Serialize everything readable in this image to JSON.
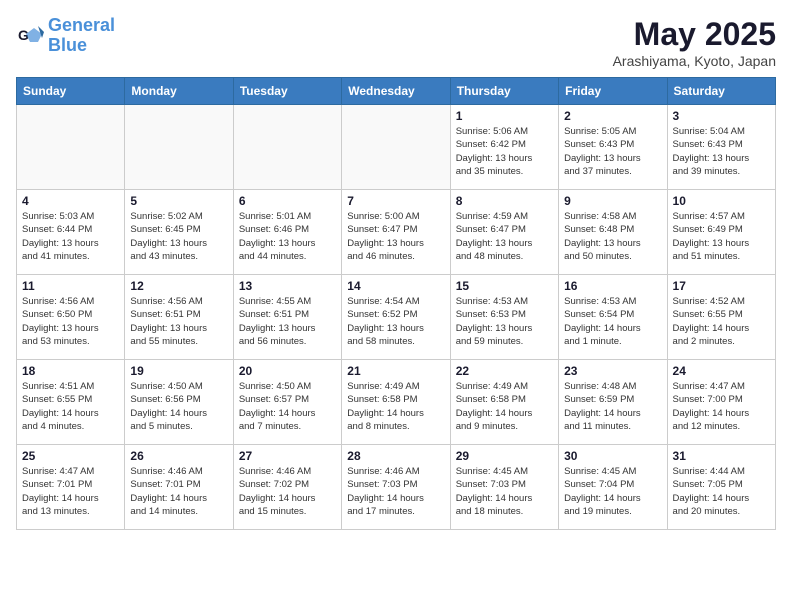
{
  "header": {
    "logo_line1": "General",
    "logo_line2": "Blue",
    "month": "May 2025",
    "location": "Arashiyama, Kyoto, Japan"
  },
  "weekdays": [
    "Sunday",
    "Monday",
    "Tuesday",
    "Wednesday",
    "Thursday",
    "Friday",
    "Saturday"
  ],
  "weeks": [
    [
      {
        "day": "",
        "info": ""
      },
      {
        "day": "",
        "info": ""
      },
      {
        "day": "",
        "info": ""
      },
      {
        "day": "",
        "info": ""
      },
      {
        "day": "1",
        "info": "Sunrise: 5:06 AM\nSunset: 6:42 PM\nDaylight: 13 hours\nand 35 minutes."
      },
      {
        "day": "2",
        "info": "Sunrise: 5:05 AM\nSunset: 6:43 PM\nDaylight: 13 hours\nand 37 minutes."
      },
      {
        "day": "3",
        "info": "Sunrise: 5:04 AM\nSunset: 6:43 PM\nDaylight: 13 hours\nand 39 minutes."
      }
    ],
    [
      {
        "day": "4",
        "info": "Sunrise: 5:03 AM\nSunset: 6:44 PM\nDaylight: 13 hours\nand 41 minutes."
      },
      {
        "day": "5",
        "info": "Sunrise: 5:02 AM\nSunset: 6:45 PM\nDaylight: 13 hours\nand 43 minutes."
      },
      {
        "day": "6",
        "info": "Sunrise: 5:01 AM\nSunset: 6:46 PM\nDaylight: 13 hours\nand 44 minutes."
      },
      {
        "day": "7",
        "info": "Sunrise: 5:00 AM\nSunset: 6:47 PM\nDaylight: 13 hours\nand 46 minutes."
      },
      {
        "day": "8",
        "info": "Sunrise: 4:59 AM\nSunset: 6:47 PM\nDaylight: 13 hours\nand 48 minutes."
      },
      {
        "day": "9",
        "info": "Sunrise: 4:58 AM\nSunset: 6:48 PM\nDaylight: 13 hours\nand 50 minutes."
      },
      {
        "day": "10",
        "info": "Sunrise: 4:57 AM\nSunset: 6:49 PM\nDaylight: 13 hours\nand 51 minutes."
      }
    ],
    [
      {
        "day": "11",
        "info": "Sunrise: 4:56 AM\nSunset: 6:50 PM\nDaylight: 13 hours\nand 53 minutes."
      },
      {
        "day": "12",
        "info": "Sunrise: 4:56 AM\nSunset: 6:51 PM\nDaylight: 13 hours\nand 55 minutes."
      },
      {
        "day": "13",
        "info": "Sunrise: 4:55 AM\nSunset: 6:51 PM\nDaylight: 13 hours\nand 56 minutes."
      },
      {
        "day": "14",
        "info": "Sunrise: 4:54 AM\nSunset: 6:52 PM\nDaylight: 13 hours\nand 58 minutes."
      },
      {
        "day": "15",
        "info": "Sunrise: 4:53 AM\nSunset: 6:53 PM\nDaylight: 13 hours\nand 59 minutes."
      },
      {
        "day": "16",
        "info": "Sunrise: 4:53 AM\nSunset: 6:54 PM\nDaylight: 14 hours\nand 1 minute."
      },
      {
        "day": "17",
        "info": "Sunrise: 4:52 AM\nSunset: 6:55 PM\nDaylight: 14 hours\nand 2 minutes."
      }
    ],
    [
      {
        "day": "18",
        "info": "Sunrise: 4:51 AM\nSunset: 6:55 PM\nDaylight: 14 hours\nand 4 minutes."
      },
      {
        "day": "19",
        "info": "Sunrise: 4:50 AM\nSunset: 6:56 PM\nDaylight: 14 hours\nand 5 minutes."
      },
      {
        "day": "20",
        "info": "Sunrise: 4:50 AM\nSunset: 6:57 PM\nDaylight: 14 hours\nand 7 minutes."
      },
      {
        "day": "21",
        "info": "Sunrise: 4:49 AM\nSunset: 6:58 PM\nDaylight: 14 hours\nand 8 minutes."
      },
      {
        "day": "22",
        "info": "Sunrise: 4:49 AM\nSunset: 6:58 PM\nDaylight: 14 hours\nand 9 minutes."
      },
      {
        "day": "23",
        "info": "Sunrise: 4:48 AM\nSunset: 6:59 PM\nDaylight: 14 hours\nand 11 minutes."
      },
      {
        "day": "24",
        "info": "Sunrise: 4:47 AM\nSunset: 7:00 PM\nDaylight: 14 hours\nand 12 minutes."
      }
    ],
    [
      {
        "day": "25",
        "info": "Sunrise: 4:47 AM\nSunset: 7:01 PM\nDaylight: 14 hours\nand 13 minutes."
      },
      {
        "day": "26",
        "info": "Sunrise: 4:46 AM\nSunset: 7:01 PM\nDaylight: 14 hours\nand 14 minutes."
      },
      {
        "day": "27",
        "info": "Sunrise: 4:46 AM\nSunset: 7:02 PM\nDaylight: 14 hours\nand 15 minutes."
      },
      {
        "day": "28",
        "info": "Sunrise: 4:46 AM\nSunset: 7:03 PM\nDaylight: 14 hours\nand 17 minutes."
      },
      {
        "day": "29",
        "info": "Sunrise: 4:45 AM\nSunset: 7:03 PM\nDaylight: 14 hours\nand 18 minutes."
      },
      {
        "day": "30",
        "info": "Sunrise: 4:45 AM\nSunset: 7:04 PM\nDaylight: 14 hours\nand 19 minutes."
      },
      {
        "day": "31",
        "info": "Sunrise: 4:44 AM\nSunset: 7:05 PM\nDaylight: 14 hours\nand 20 minutes."
      }
    ]
  ]
}
